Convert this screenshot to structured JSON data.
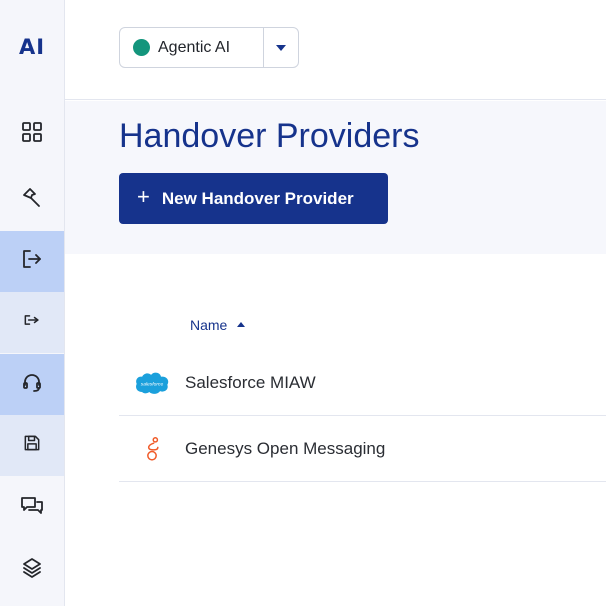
{
  "app": {
    "logo_text": "AI"
  },
  "sidebar": {
    "items": [
      {
        "name": "dashboard",
        "icon": "grid-icon"
      },
      {
        "name": "tools",
        "icon": "hammer-icon"
      },
      {
        "name": "handover",
        "icon": "sign-out-icon",
        "active": true
      },
      {
        "name": "handover-providers",
        "icon": "forward-icon"
      },
      {
        "name": "support",
        "icon": "headset-icon"
      },
      {
        "name": "storage",
        "icon": "save-icon"
      },
      {
        "name": "conversations",
        "icon": "chat-icon"
      },
      {
        "name": "layers",
        "icon": "stack-icon"
      }
    ]
  },
  "topbar": {
    "agent_selector": {
      "label": "Agentic AI",
      "status_color": "#13957c"
    }
  },
  "header": {
    "title": "Handover Providers",
    "new_button_label": "New Handover Provider",
    "new_button_icon": "+"
  },
  "table": {
    "columns": [
      {
        "label": "Name",
        "sort": "ascending"
      }
    ],
    "rows": [
      {
        "name": "Salesforce MIAW",
        "icon": "salesforce-logo",
        "logo_text": "salesforce"
      },
      {
        "name": "Genesys Open Messaging",
        "icon": "genesys-logo"
      }
    ]
  },
  "colors": {
    "brand": "#16338c",
    "active_nav": "#bcd0f6",
    "header_band": "#f6f7fc"
  }
}
